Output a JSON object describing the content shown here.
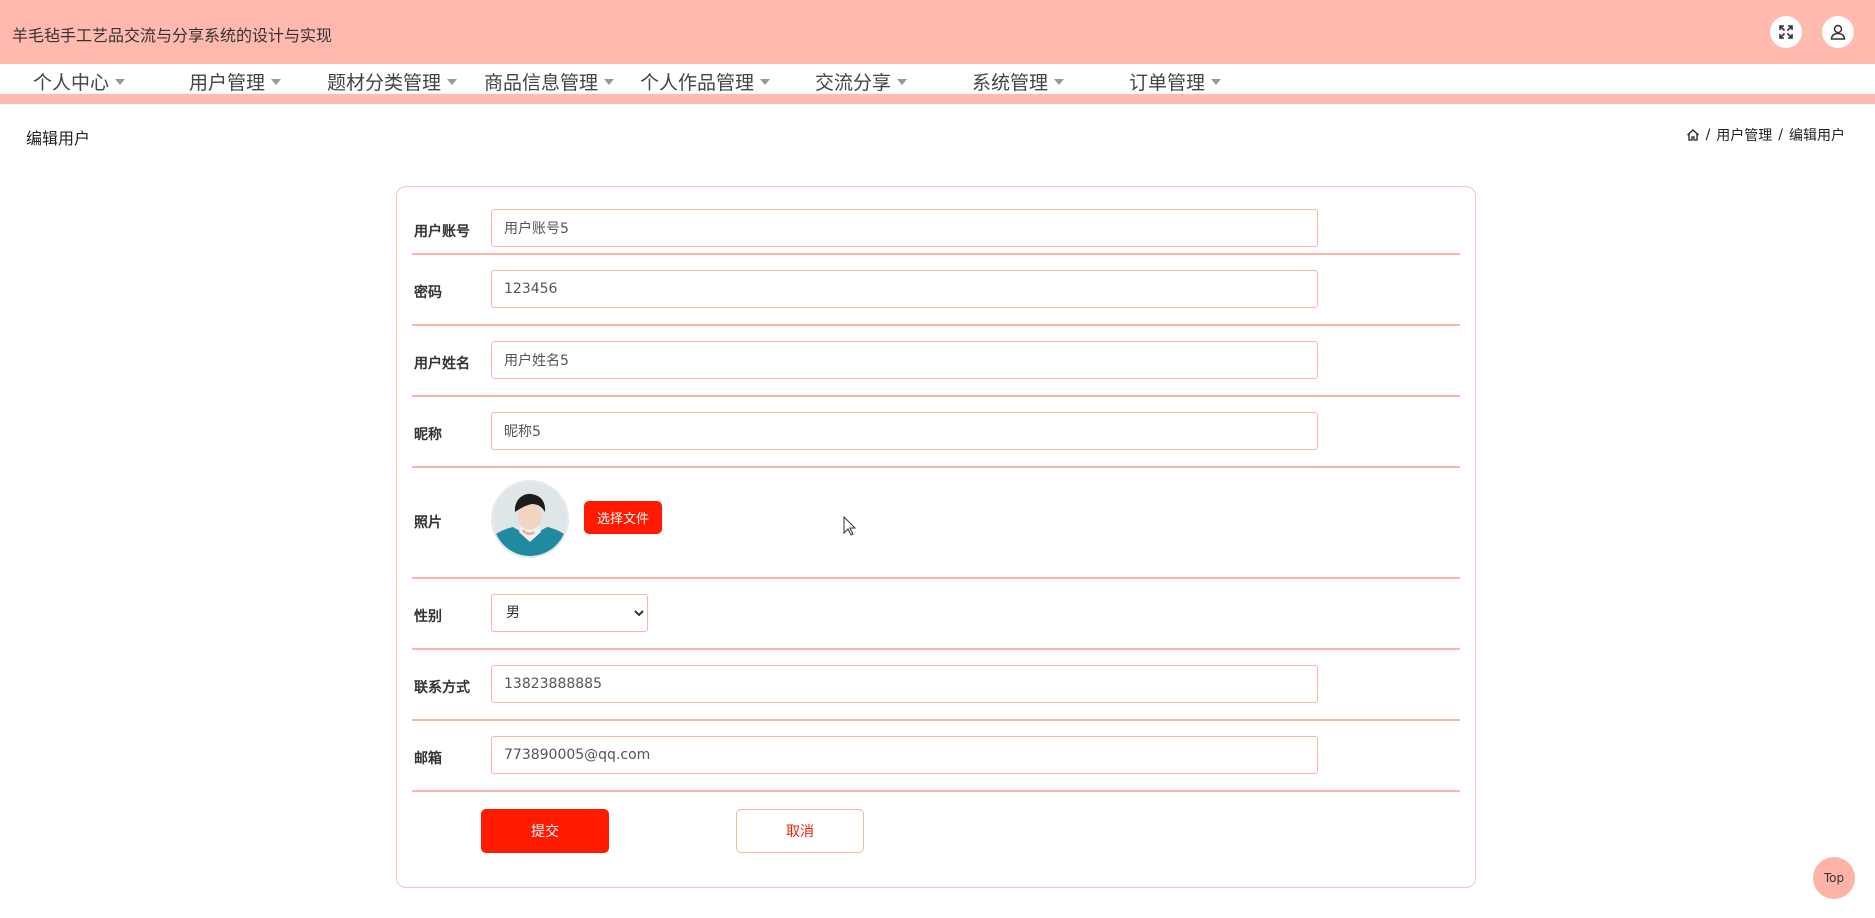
{
  "header": {
    "title": "羊毛毡手工艺品交流与分享系统的设计与实现",
    "fullscreen_icon": "expand-icon",
    "user_icon": "user-icon"
  },
  "nav": {
    "items": [
      {
        "label": "个人中心"
      },
      {
        "label": "用户管理"
      },
      {
        "label": "题材分类管理"
      },
      {
        "label": "商品信息管理"
      },
      {
        "label": "个人作品管理"
      },
      {
        "label": "交流分享"
      },
      {
        "label": "系统管理"
      },
      {
        "label": "订单管理"
      }
    ]
  },
  "page": {
    "title": "编辑用户",
    "breadcrumb": {
      "home_icon": "home-icon",
      "separator": "/",
      "items": [
        "用户管理",
        "编辑用户"
      ]
    }
  },
  "form": {
    "account": {
      "label": "用户账号",
      "value": "用户账号5"
    },
    "password": {
      "label": "密码",
      "value": "123456"
    },
    "name": {
      "label": "用户姓名",
      "value": "用户姓名5"
    },
    "nickname": {
      "label": "昵称",
      "value": "昵称5"
    },
    "photo": {
      "label": "照片",
      "button": "选择文件"
    },
    "gender": {
      "label": "性别",
      "selected": "男"
    },
    "phone": {
      "label": "联系方式",
      "value": "13823888885"
    },
    "email": {
      "label": "邮箱",
      "value": "773890005@qq.com"
    },
    "submit_label": "提交",
    "cancel_label": "取消"
  },
  "top_button": "Top",
  "colors": {
    "header_bg": "#ffb9ae",
    "primary": "#ff1a00",
    "border": "#ffb3a7"
  }
}
